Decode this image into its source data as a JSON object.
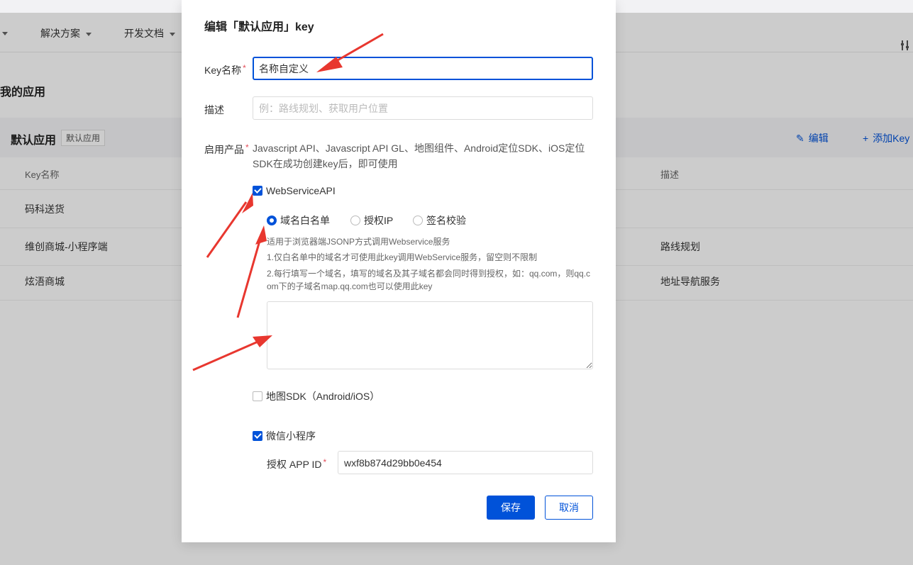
{
  "nav": {
    "items": [
      {
        "label": "解决方案"
      },
      {
        "label": "开发文档"
      }
    ]
  },
  "page": {
    "title": "我的应用"
  },
  "app": {
    "name": "默认应用",
    "badge": "默认应用",
    "edit_label": "编辑",
    "add_key_label": "添加Key",
    "columns": [
      "Key名称",
      "描述"
    ],
    "rows": [
      {
        "name": "码科送货",
        "desc": ""
      },
      {
        "name": "维创商城-小程序端",
        "desc": "路线规划"
      },
      {
        "name": "炫浯商城",
        "desc": "地址导航服务"
      }
    ]
  },
  "dialog": {
    "title": "编辑「默认应用」key",
    "key_name_label": "Key名称",
    "key_name_value": "名称自定义",
    "desc_label": "描述",
    "desc_placeholder": "例：路线规划、获取用户位置",
    "products_label": "启用产品",
    "products_text": "Javascript API、Javascript API GL、地图组件、Android定位SDK、iOS定位SDK在成功创建key后，即可使用",
    "webservice": {
      "label": "WebServiceAPI",
      "checked": true,
      "options": [
        {
          "label": "域名白名单",
          "selected": true
        },
        {
          "label": "授权IP",
          "selected": false
        },
        {
          "label": "签名校验",
          "selected": false
        }
      ],
      "help_lines": [
        "适用于浏览器端JSONP方式调用Webservice服务",
        "1.仅白名单中的域名才可使用此key调用WebService服务，留空则不限制",
        "2.每行填写一个域名，填写的域名及其子域名都会同时得到授权，如：qq.com，则qq.c",
        "om下的子域名map.qq.com也可以使用此key"
      ],
      "textarea_value": ""
    },
    "sdk": {
      "label": "地图SDK（Android/iOS）",
      "checked": false
    },
    "miniprogram": {
      "label": "微信小程序",
      "checked": true,
      "app_id_label": "授权 APP ID",
      "app_id_value": "wxf8b874d29bb0e454"
    },
    "save_label": "保存",
    "cancel_label": "取消"
  },
  "colors": {
    "primary": "#0052d9",
    "required": "#e34d59",
    "annotation_arrow": "#e8372f"
  }
}
